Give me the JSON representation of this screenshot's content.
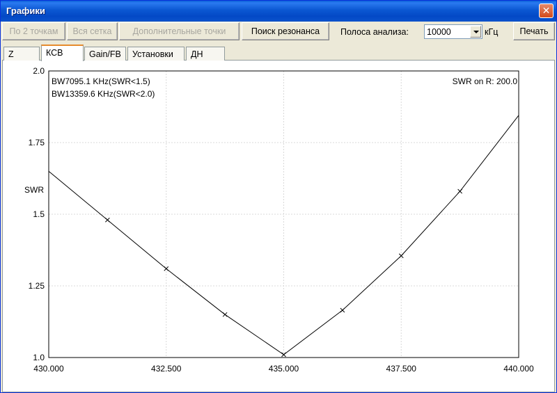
{
  "window": {
    "title": "Графики",
    "close_symbol": "✕"
  },
  "toolbar": {
    "btn_two_points": "По 2 точкам",
    "btn_all_grid": "Вся сетка",
    "btn_extra_points": "Дополнительные точки",
    "btn_find_resonance": "Поиск резонанса",
    "band_label": "Полоса анализа:",
    "band_value": "10000",
    "band_unit": "кГц",
    "btn_print": "Печать"
  },
  "tabs": [
    {
      "label": "Z"
    },
    {
      "label": "КСВ"
    },
    {
      "label": "Gain/FB"
    },
    {
      "label": "Установки"
    },
    {
      "label": "ДН"
    }
  ],
  "active_tab": "КСВ",
  "chart_data": {
    "type": "line",
    "title": "",
    "xlabel": "",
    "ylabel": "SWR",
    "xlim": [
      430.0,
      440.0
    ],
    "ylim": [
      1.0,
      2.0
    ],
    "x_ticks": [
      "430.000",
      "432.500",
      "435.000",
      "437.500",
      "440.000"
    ],
    "x_tick_values": [
      430.0,
      432.5,
      435.0,
      437.5,
      440.0
    ],
    "y_ticks": [
      "1.0",
      "1.25",
      "1.5",
      "1.75",
      "2.0"
    ],
    "y_tick_values": [
      1.0,
      1.25,
      1.5,
      1.75,
      2.0
    ],
    "grid": true,
    "annotations": [
      "BW7095.1 KHz(SWR<1.5)",
      "BW13359.6 KHz(SWR<2.0)"
    ],
    "annotation_right": "SWR on R: 200.0",
    "series": [
      {
        "x": [
          430.0,
          431.25,
          432.5,
          433.75,
          435.0,
          436.25,
          437.5,
          438.75,
          440.0
        ],
        "y": [
          1.65,
          1.48,
          1.31,
          1.15,
          1.01,
          1.165,
          1.355,
          1.58,
          1.845
        ],
        "color": "#000000"
      }
    ]
  }
}
